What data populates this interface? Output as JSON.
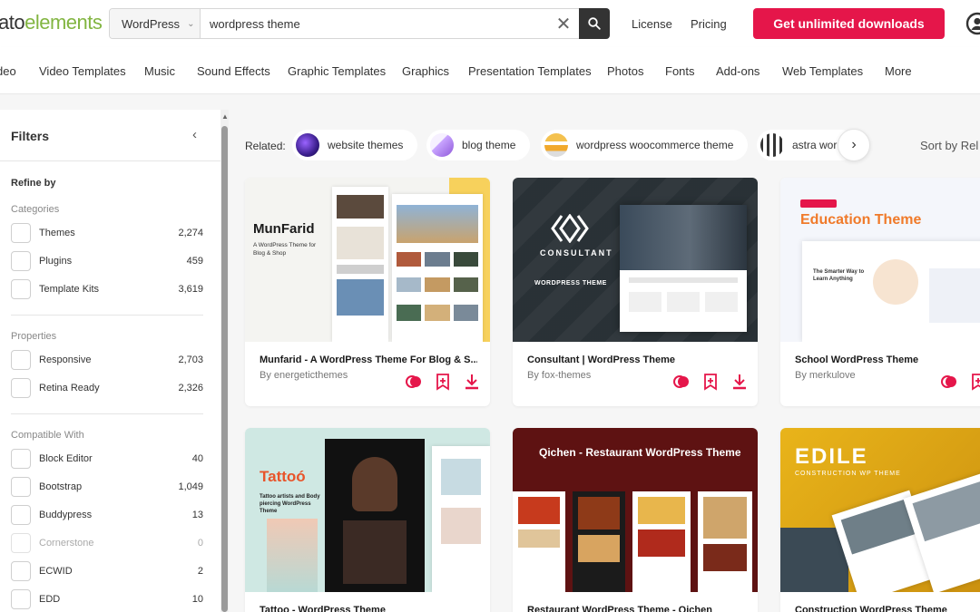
{
  "header": {
    "logo_text": "ato",
    "logo_text2": "elements",
    "search_category": "WordPress",
    "search_value": "wordpress theme",
    "links": [
      "License",
      "Pricing"
    ],
    "cta_label": "Get unlimited downloads"
  },
  "nav": [
    "deo",
    "Video Templates",
    "Music",
    "Sound Effects",
    "Graphic Templates",
    "Graphics",
    "Presentation Templates",
    "Photos",
    "Fonts",
    "Add-ons",
    "Web Templates",
    "More"
  ],
  "sidebar": {
    "title": "Filters",
    "refine_by": "Refine by",
    "groups": [
      {
        "title": "Categories",
        "options": [
          {
            "label": "Themes",
            "count": "2,274"
          },
          {
            "label": "Plugins",
            "count": "459"
          },
          {
            "label": "Template Kits",
            "count": "3,619"
          }
        ]
      },
      {
        "title": "Properties",
        "options": [
          {
            "label": "Responsive",
            "count": "2,703"
          },
          {
            "label": "Retina Ready",
            "count": "2,326"
          }
        ]
      },
      {
        "title": "Compatible With",
        "options": [
          {
            "label": "Block Editor",
            "count": "40"
          },
          {
            "label": "Bootstrap",
            "count": "1,049"
          },
          {
            "label": "Buddypress",
            "count": "13"
          },
          {
            "label": "Cornerstone",
            "count": "0"
          },
          {
            "label": "ECWID",
            "count": "2"
          },
          {
            "label": "EDD",
            "count": "10"
          }
        ]
      }
    ]
  },
  "related": {
    "label": "Related:",
    "chips": [
      "website themes",
      "blog theme",
      "wordpress woocommerce theme",
      "astra wor"
    ]
  },
  "sort_label": "Sort by Rel",
  "cards": [
    {
      "title": "Munfarid - A WordPress Theme For Blog & S...",
      "author": "By energeticthemes",
      "img_heading": "MunFarid",
      "img_sub": "A WordPress Theme for Blog & Shop"
    },
    {
      "title": "Consultant | WordPress Theme",
      "author": "By fox-themes",
      "img_heading": "CONSULTANT",
      "img_sub": "WORDPRESS THEME"
    },
    {
      "title": "School WordPress Theme",
      "author": "By merkulove",
      "img_heading": "Education Theme",
      "img_sub": "The Smarter Way to Learn Anything"
    },
    {
      "title": "Tattoo - WordPress Theme",
      "author": "",
      "img_heading": "Tattoó",
      "img_sub": "Tattoo artists and Body piercing WordPress Theme"
    },
    {
      "title": "Restaurant WordPress Theme - Qichen",
      "author": "",
      "img_heading": "Qichen - Restaurant WordPress Theme",
      "img_sub": ""
    },
    {
      "title": "Construction WordPress Theme",
      "author": "",
      "img_heading": "EDILE",
      "img_sub": "CONSTRUCTION WP THEME"
    }
  ],
  "colors": {
    "accent": "#e5164a",
    "logo": "#82b541"
  }
}
